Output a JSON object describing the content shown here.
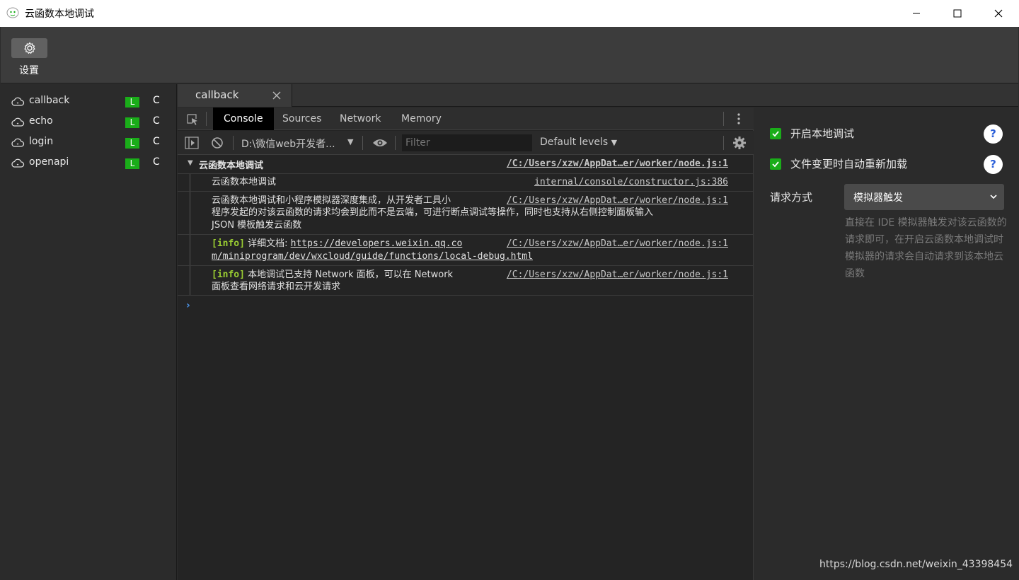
{
  "window": {
    "title": "云函数本地调试"
  },
  "toolbar": {
    "settings_label": "设置"
  },
  "sidebar": {
    "items": [
      {
        "label": "callback",
        "badge_l": "L",
        "badge_c": "C"
      },
      {
        "label": "echo",
        "badge_l": "L",
        "badge_c": "C"
      },
      {
        "label": "login",
        "badge_l": "L",
        "badge_c": "C"
      },
      {
        "label": "openapi",
        "badge_l": "L",
        "badge_c": "C"
      }
    ]
  },
  "tabs": [
    {
      "label": "callback"
    }
  ],
  "devtools": {
    "tabs": [
      "Console",
      "Sources",
      "Network",
      "Memory"
    ],
    "active_tab": "Console",
    "context": "D:\\微信web开发者...",
    "filter_placeholder": "Filter",
    "levels": "Default levels"
  },
  "console": {
    "group_title": "云函数本地调试",
    "group_source": "/C:/Users/xzw/AppDat…er/worker/node.js:1",
    "entries": [
      {
        "text": "云函数本地调试",
        "source": "internal/console/constructor.js:386"
      },
      {
        "line1": "云函数本地调试和小程序模拟器深度集成，从开发者工具小",
        "line2": "程序发起的对该云函数的请求均会到此而不是云端，可进行断点调试等操作，同时也支持从右侧控制面板输入",
        "line3": "JSON 模板触发云函数",
        "source": "/C:/Users/xzw/AppDat…er/worker/node.js:1"
      },
      {
        "tag": "[info]",
        "prefix": "详细文档:",
        "url1": "https://developers.weixin.qq.co",
        "url2": "m/miniprogram/dev/wxcloud/guide/functions/local-debug.html",
        "source": "/C:/Users/xzw/AppDat…er/worker/node.js:1"
      },
      {
        "tag": "[info]",
        "line1": "本地调试已支持 Network 面板，可以在 Network",
        "line2": "面板查看网络请求和云开发请求",
        "source": "/C:/Users/xzw/AppDat…er/worker/node.js:1"
      }
    ],
    "prompt": "›"
  },
  "right_panel": {
    "enable_local_debug": {
      "label": "开启本地调试",
      "checked": true
    },
    "auto_reload": {
      "label": "文件变更时自动重新加载",
      "checked": true
    },
    "help_glyph": "?",
    "request_method_label": "请求方式",
    "request_method_value": "模拟器触发",
    "description": "直接在 IDE 模拟器触发对该云函数的请求即可，在开启云函数本地调试时模拟器的请求会自动请求到该本地云函数"
  },
  "watermark": "https://blog.csdn.net/weixin_43398454",
  "colors": {
    "accent_green": "#1aad19",
    "help_blue": "#2b5fd9"
  }
}
